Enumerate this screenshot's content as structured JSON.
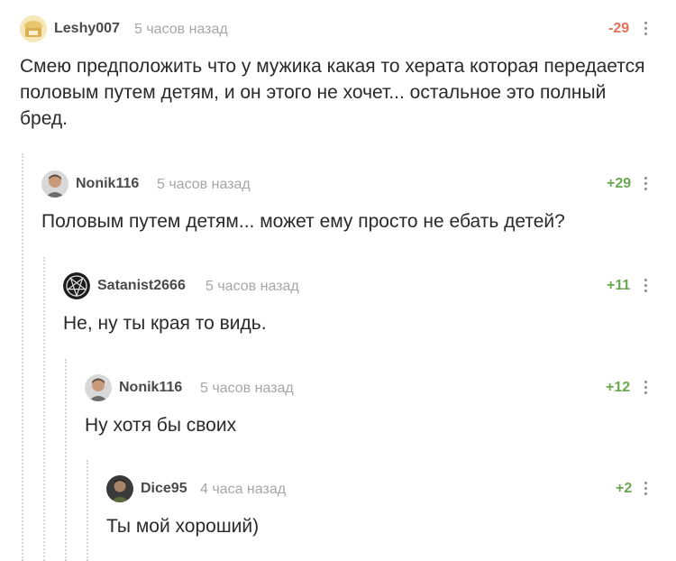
{
  "comments": [
    {
      "username": "Leshy007",
      "time": "5 часов назад",
      "rating": "-29",
      "avatar": "hat-avatar-icon",
      "text": "Смею предположить что у мужика какая то херата которая передается половым путем детям, и он этого не хочет... остальное это полный бред."
    },
    {
      "username": "Nonik116",
      "time": "5 часов назад",
      "rating": "+29",
      "avatar": "man-avatar-icon",
      "text": "Половым путем детям... может ему просто не ебать детей?"
    },
    {
      "username": "Satanist2666",
      "time": "5 часов назад",
      "rating": "+11",
      "avatar": "pentagram-avatar-icon",
      "text": "Не, ну ты края то видь."
    },
    {
      "username": "Nonik116",
      "time": "5 часов назад",
      "rating": "+12",
      "avatar": "man-avatar-icon",
      "text": "Ну хотя бы своих"
    },
    {
      "username": "Dice95",
      "time": "4 часа назад",
      "rating": "+2",
      "avatar": "person-avatar-icon",
      "text": "Ты мой хороший)"
    }
  ],
  "colors": {
    "negative": "#e46f5a",
    "positive": "#6aa84f",
    "username": "#4a4a4a",
    "meta": "#a6a6a6"
  }
}
